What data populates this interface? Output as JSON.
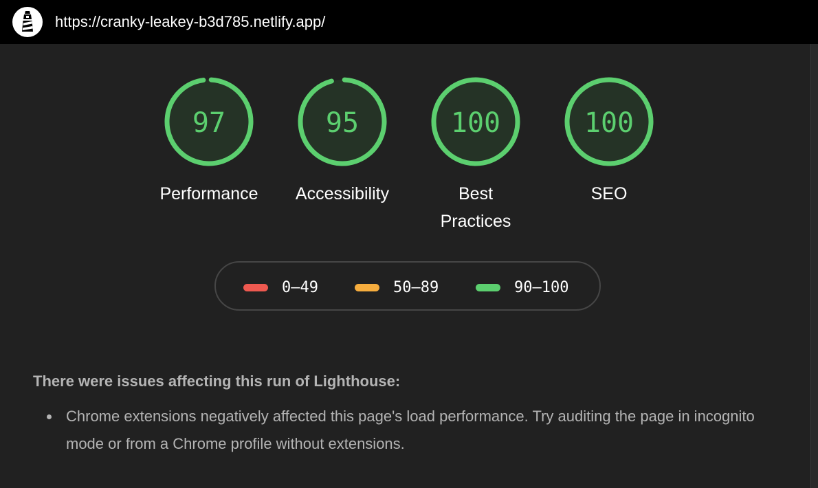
{
  "header": {
    "url": "https://cranky-leakey-b3d785.netlify.app/",
    "logo_icon": "lighthouse-icon"
  },
  "gauges": [
    {
      "score": 97,
      "label": "Performance"
    },
    {
      "score": 95,
      "label": "Accessibility"
    },
    {
      "score": 100,
      "label": "Best Practices"
    },
    {
      "score": 100,
      "label": "SEO"
    }
  ],
  "colors": {
    "pass": "#5ccf6f",
    "average": "#f6ad3e",
    "fail": "#ee5950",
    "gauge_fill": "#253326",
    "background": "#212121",
    "topbar": "#000000"
  },
  "legend": [
    {
      "range": "0–49",
      "color": "#ee5950"
    },
    {
      "range": "50–89",
      "color": "#f6ad3e"
    },
    {
      "range": "90–100",
      "color": "#5ccf6f"
    }
  ],
  "warnings": {
    "title": "There were issues affecting this run of Lighthouse:",
    "items": [
      "Chrome extensions negatively affected this page's load performance. Try auditing the page in incognito mode or from a Chrome profile without extensions."
    ]
  }
}
